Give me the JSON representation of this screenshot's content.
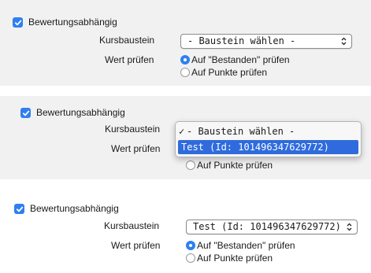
{
  "accent_color": "#2f7ff0",
  "highlight_color": "#2f6bdc",
  "panels": [
    {
      "checkbox_label": "Bewertungsabhängig",
      "checked": true,
      "kursbaustein_label": "Kursbaustein",
      "select_value": "- Baustein wählen -",
      "wert_label": "Wert prüfen",
      "radio_bestanden": "Auf \"Bestanden\" prüfen",
      "radio_punkte": "Auf Punkte prüfen",
      "selected_radio": "bestanden"
    },
    {
      "checkbox_label": "Bewertungsabhängig",
      "checked": true,
      "kursbaustein_label": "Kursbaustein",
      "wert_label": "Wert prüfen",
      "radio_punkte": "Auf Punkte prüfen",
      "dropdown": {
        "check_mark": "✓",
        "options": [
          "- Baustein wählen -",
          "Test (Id: 101496347629772)"
        ],
        "checked_option": "- Baustein wählen -",
        "highlighted_option": "Test (Id: 101496347629772)"
      }
    },
    {
      "checkbox_label": "Bewertungsabhängig",
      "checked": true,
      "kursbaustein_label": "Kursbaustein",
      "select_value": "Test (Id: 101496347629772)",
      "wert_label": "Wert prüfen",
      "radio_bestanden": "Auf \"Bestanden\" prüfen",
      "radio_punkte": "Auf Punkte prüfen",
      "selected_radio": "bestanden"
    }
  ]
}
